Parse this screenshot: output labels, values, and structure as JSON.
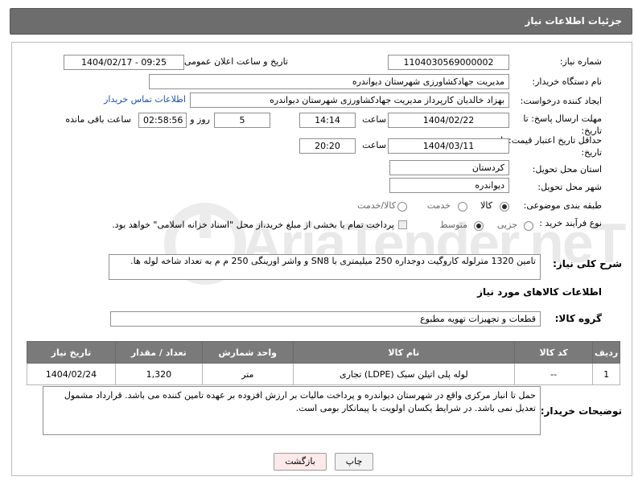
{
  "header": {
    "title": "جزئیات اطلاعات نیاز"
  },
  "form": {
    "need_number_label": "شماره نیاز:",
    "need_number": "1104030569000002",
    "announce_label": "تاریخ و ساعت اعلان عمومی:",
    "announce_value": "1404/02/17 - 09:25",
    "buyer_org_label": "نام دستگاه خریدار:",
    "buyer_org": "مدیریت جهادکشاورزی شهرستان دیواندره",
    "creator_label": "ایجاد کننده درخواست:",
    "creator": "بهزاد خالدیان کارپرداز مدیریت جهادکشاورزی شهرستان دیواندره",
    "contact_link": "اطلاعات تماس خریدار",
    "reply_deadline_label": "مهلت ارسال پاسخ: تا تاریخ:",
    "reply_date": "1404/02/22",
    "hour_label": "ساعت",
    "reply_time": "14:14",
    "days_value": "5",
    "days_label": "روز و",
    "remaining_time": "02:58:56",
    "remaining_label": "ساعت باقی مانده",
    "price_validity_label": "حداقل تاریخ اعتبار قیمت: تا تاریخ:",
    "validity_date": "1404/03/11",
    "validity_hour_label": "ساعت",
    "validity_time": "20:20",
    "province_label": "استان محل تحویل:",
    "province": "کردستان",
    "city_label": "شهر محل تحویل:",
    "city": "دیواندره",
    "category_label": "طبقه بندی موضوعی:",
    "category_options": [
      "کالا",
      "خدمت",
      "کالا/خدمت"
    ],
    "purchase_type_label": "نوع فرآیند خرید :",
    "purchase_options": [
      "جزیی",
      "متوسط"
    ],
    "payment_note": "پرداخت تمام یا بخشی از مبلغ خرید،از محل \"اسناد خزانه اسلامی\" خواهد بود."
  },
  "description": {
    "label": "شرح کلی نیاز:",
    "text": "تامین 1320 مترلوله کاروگیت دوجداره 250 میلیمتری با SN8 و واشر اورینگی 250 م م به تعداد شاخه لوله ها."
  },
  "goods_section": {
    "title": "اطلاعات کالاهای مورد نیاز",
    "group_label": "گروه کالا:",
    "group_value": "قطعات و تجهیزات تهویه مطبوع"
  },
  "table": {
    "headers": [
      "ردیف",
      "کد کالا",
      "نام کالا",
      "واحد شمارش",
      "تعداد / مقدار",
      "تاریخ نیاز"
    ],
    "rows": [
      {
        "index": "1",
        "code": "--",
        "name": "لوله پلی اتیلن سبک (LDPE) تجاری",
        "unit": "متر",
        "qty": "1,320",
        "date": "1404/02/24"
      }
    ]
  },
  "buyer_notes": {
    "label": "توضیحات خریدار:",
    "text": "حمل تا انبار مرکزی واقع در شهرستان دیواندره  و پرداخت مالیات بر ارزش افزوده بر عهده تامین کننده می باشد. قرارداد مشمول تعدیل نمی باشد. در شرایط یکسان اولویت با پیمانکار بومی است."
  },
  "buttons": {
    "print": "چاپ",
    "back": "بازگشت"
  },
  "watermark": {
    "text": "AriaTender.neT"
  },
  "colors": {
    "header_bg": "#6d6d6d",
    "table_header_bg": "#7a7a7a",
    "link": "#1f4fb2",
    "back_button_bg": "#fde9e9"
  }
}
